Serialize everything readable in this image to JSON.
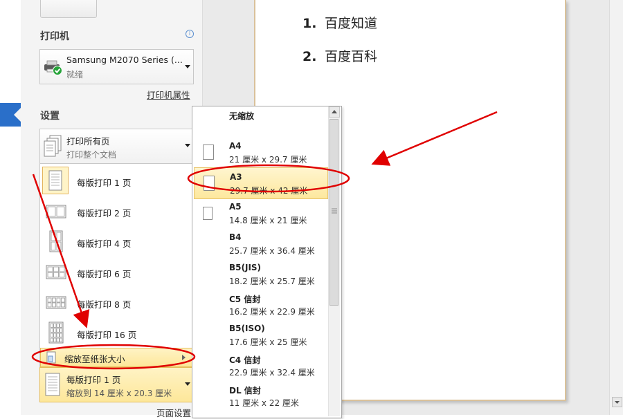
{
  "printer": {
    "section_title": "打印机",
    "name": "Samsung M2070 Series (...",
    "status": "就绪",
    "properties_link": "打印机属性"
  },
  "settings": {
    "section_title": "设置",
    "print_range": {
      "title": "打印所有页",
      "subtitle": "打印整个文档"
    },
    "pages_per_sheet_options": [
      {
        "label": "每版打印 1 页"
      },
      {
        "label": "每版打印 2 页"
      },
      {
        "label": "每版打印 4 页"
      },
      {
        "label": "每版打印 6 页"
      },
      {
        "label": "每版打印 8 页"
      },
      {
        "label": "每版打印 16 页"
      }
    ],
    "scale_to_paper": {
      "label": "缩放至纸张大小"
    },
    "current": {
      "title": "每版打印 1 页",
      "subtitle": "缩放到 14 厘米 x 20.3 厘米"
    },
    "page_setup_link": "页面设置"
  },
  "paper_menu": {
    "header": "无缩放",
    "items": [
      {
        "name": "A4",
        "dims": "21 厘米 x 29.7 厘米",
        "icon": "paper-portrait-icon"
      },
      {
        "name": "A3",
        "dims": "29.7 厘米 x 42 厘米",
        "icon": "paper-portrait-icon",
        "selected": true
      },
      {
        "name": "A5",
        "dims": "14.8 厘米 x 21 厘米",
        "icon": "paper-portrait-icon"
      },
      {
        "name": "B4",
        "dims": "25.7 厘米 x 36.4 厘米"
      },
      {
        "name": "B5(JIS)",
        "dims": "18.2 厘米 x 25.7 厘米"
      },
      {
        "name": "C5 信封",
        "dims": "16.2 厘米 x 22.9 厘米"
      },
      {
        "name": "B5(ISO)",
        "dims": "17.6 厘米 x 25 厘米"
      },
      {
        "name": "C4 信封",
        "dims": "22.9 厘米 x 32.4 厘米"
      },
      {
        "name": "DL 信封",
        "dims": "11 厘米 x 22 厘米"
      }
    ]
  },
  "document": {
    "lines": [
      {
        "num": "1.",
        "text": "百度知道"
      },
      {
        "num": "2.",
        "text": "百度百科"
      }
    ]
  },
  "colors": {
    "annotation_red": "#e00000",
    "highlight_fill": "#fde79a",
    "highlight_border": "#e5bd5b"
  }
}
